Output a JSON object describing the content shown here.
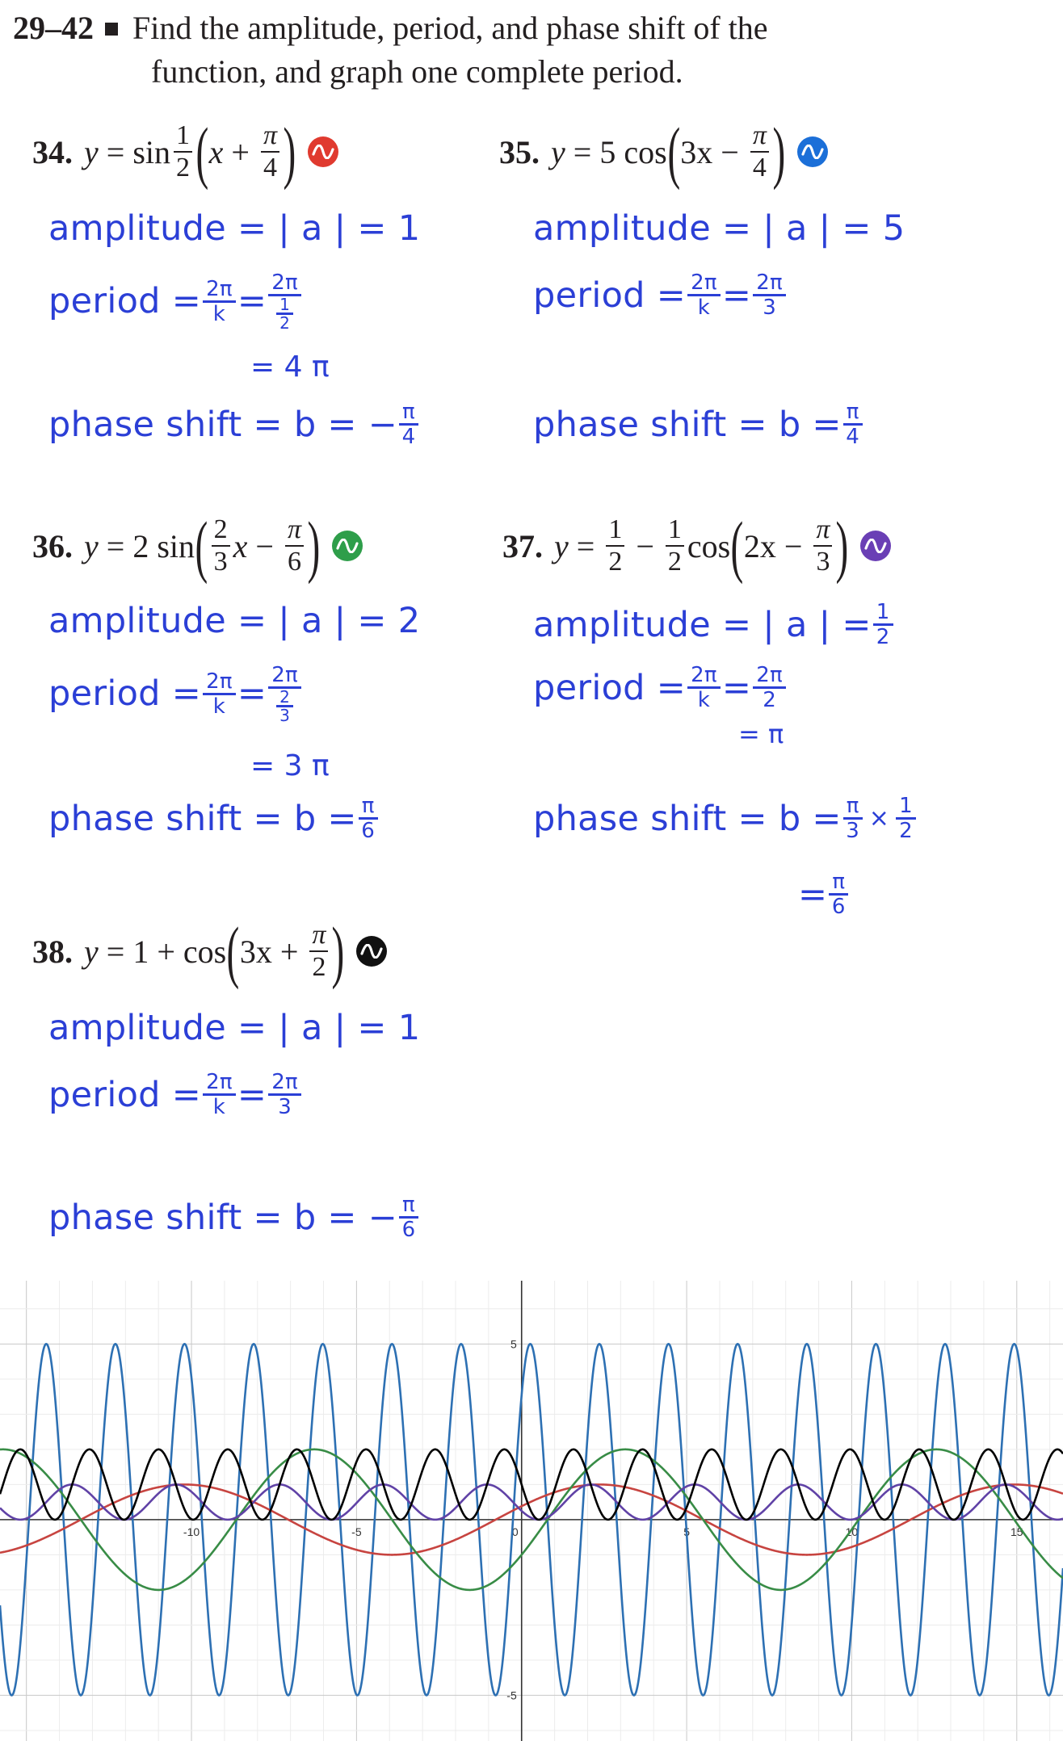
{
  "header": {
    "range": "29–42",
    "line1": "Find the amplitude, period, and phase shift of the",
    "line2": "function, and graph one complete period."
  },
  "problems": {
    "p34": {
      "num": "34.",
      "y": "y",
      "eq": "=",
      "fn": "sin",
      "frac_n": "1",
      "frac_d": "2",
      "x": "x",
      "op": "+",
      "c_n": "π",
      "c_d": "4",
      "badge_color": "#e03a2f"
    },
    "p35": {
      "num": "35.",
      "y": "y",
      "eq": "=",
      "coef": "5",
      "fn": "cos",
      "inner": "3x",
      "op": "−",
      "c_n": "π",
      "c_d": "4",
      "badge_color": "#1b6fd8"
    },
    "p36": {
      "num": "36.",
      "y": "y",
      "eq": "=",
      "coef": "2",
      "fn": "sin",
      "frac_n": "2",
      "frac_d": "3",
      "x": "x",
      "op": "−",
      "c_n": "π",
      "c_d": "6",
      "badge_color": "#2e9e4a"
    },
    "p37": {
      "num": "37.",
      "y": "y",
      "eq": "=",
      "a_n": "1",
      "a_d": "2",
      "op1": "−",
      "b_n": "1",
      "b_d": "2",
      "fn": "cos",
      "inner": "2x",
      "op": "−",
      "c_n": "π",
      "c_d": "3",
      "badge_color": "#6a3fb5"
    },
    "p38": {
      "num": "38.",
      "y": "y",
      "eq": "=",
      "const": "1",
      "op1": "+",
      "fn": "cos",
      "inner": "3x",
      "op": "+",
      "c_n": "π",
      "c_d": "2",
      "badge_color": "#111111"
    }
  },
  "notes": {
    "amp_label": "amplitude = | a | =",
    "period_label": "period =",
    "phase_label": "phase shift = b =",
    "two_pi": "2π",
    "k": "k",
    "eq": "=",
    "times": "×",
    "s34": {
      "amp": "1",
      "period_d": "1",
      "period_d2": "2",
      "period_result": "= 4 π",
      "phase_sign": "−",
      "phase_n": "π",
      "phase_d": "4"
    },
    "s35": {
      "amp": "5",
      "period_d": "3",
      "phase_n": "π",
      "phase_d": "4"
    },
    "s36": {
      "amp": "2",
      "period_d": "2",
      "period_d2": "3",
      "period_result": "= 3 π",
      "phase_n": "π",
      "phase_d": "6"
    },
    "s37": {
      "amp_n": "1",
      "amp_d": "2",
      "period_d": "2",
      "period_result": "= π",
      "phase_n": "π",
      "phase_d": "3",
      "mult_n": "1",
      "mult_d": "2",
      "result_n": "π",
      "result_d": "6"
    },
    "s38": {
      "amp": "1",
      "period_d": "3",
      "phase_sign": "−",
      "phase_n": "π",
      "phase_d": "6"
    }
  },
  "chart_data": {
    "type": "line",
    "xlim": [
      -15.8,
      16.4
    ],
    "ylim": [
      -6.3,
      6.8
    ],
    "x_ticks": [
      -10,
      -5,
      0,
      5,
      10,
      15
    ],
    "x_tick_labels": [
      "-10",
      "-5",
      "0",
      "5",
      "10",
      "15"
    ],
    "y_ticks": [
      5,
      -5
    ],
    "y_tick_labels": [
      "5",
      "-5"
    ],
    "grid": true,
    "series": [
      {
        "color": "#2d70b3",
        "function": "5 cos(3x − π/4)"
      },
      {
        "color": "#c74440",
        "function": "sin((1/2)(x + π/4))"
      },
      {
        "color": "#388c46",
        "function": "2 sin((2/3)x − π/6)"
      },
      {
        "color": "#6042a6",
        "function": "1/2 − (1/2) cos(2x − π/3)"
      },
      {
        "color": "#000000",
        "function": "1 + cos(3x + π/2)"
      }
    ]
  }
}
